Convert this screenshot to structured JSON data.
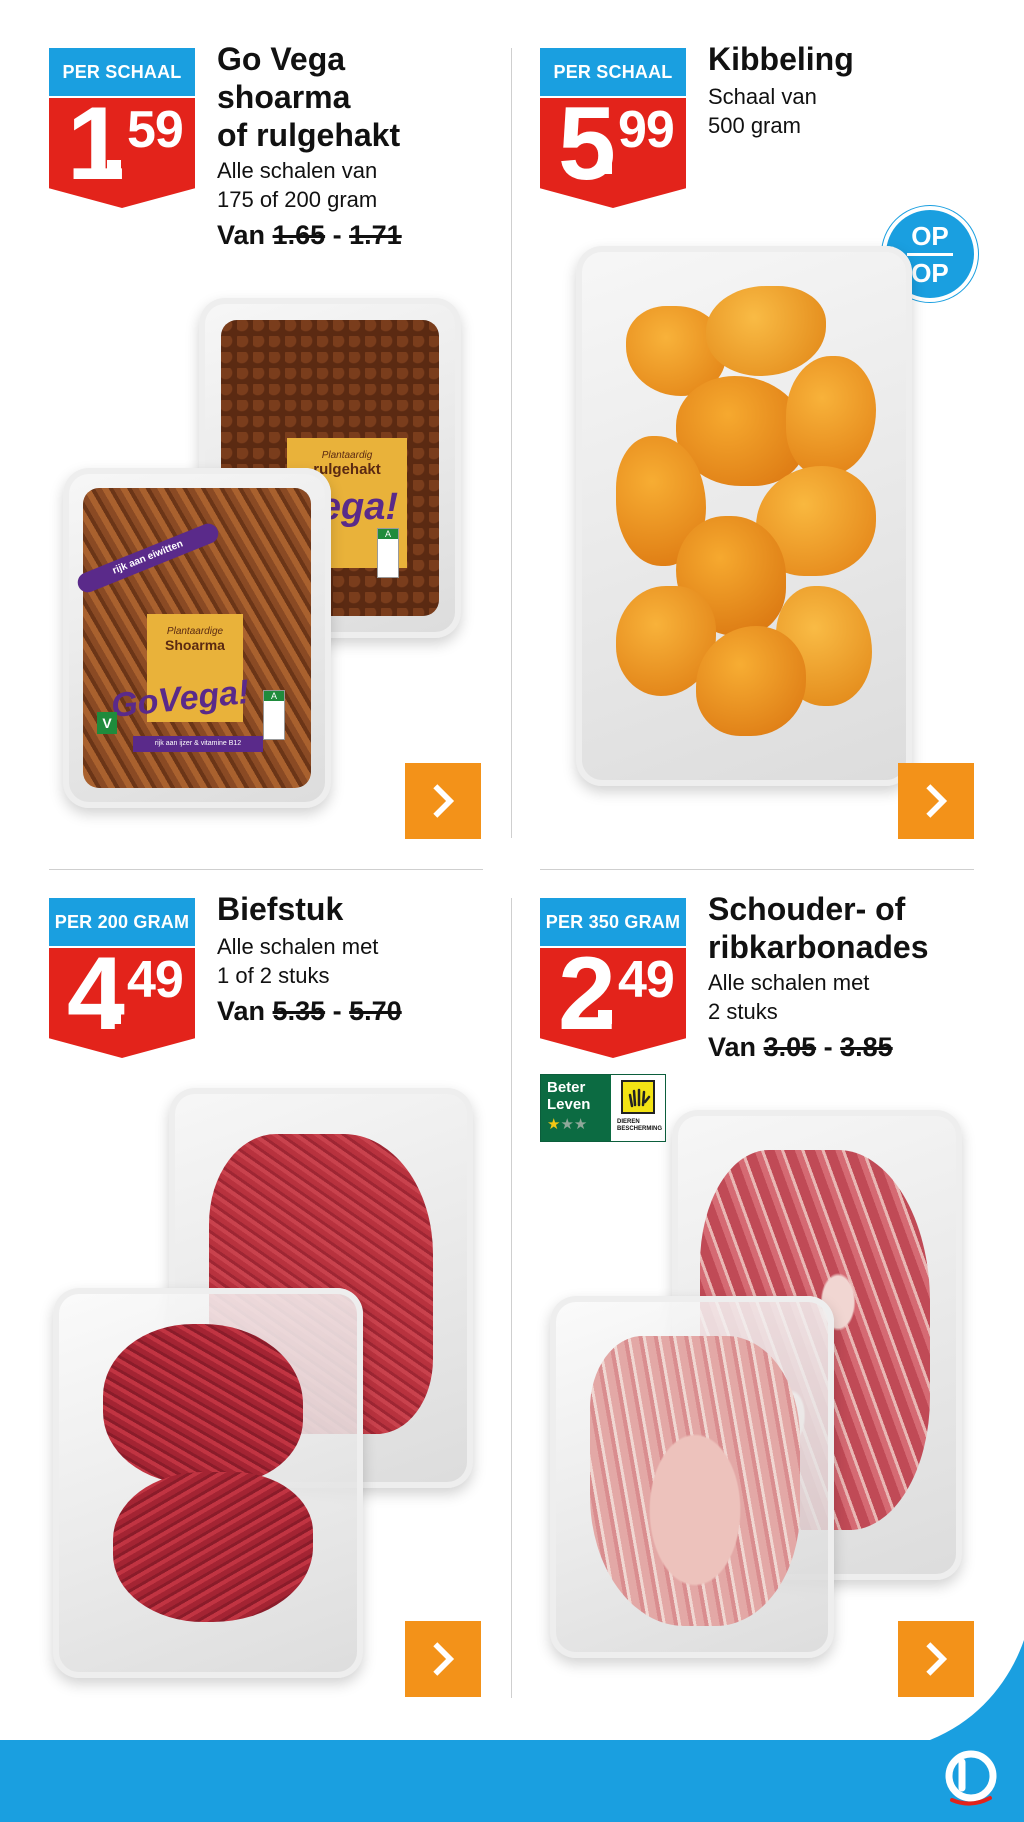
{
  "colors": {
    "price_red": "#e3231b",
    "unit_blue": "#1a9fe0",
    "arrow_orange": "#f39219",
    "beter_leven_green": "#0c6b42"
  },
  "offers": [
    {
      "unit": "PER SCHAAL",
      "price_int": "1",
      "price_dec": "59",
      "title_lines": [
        "Go Vega",
        "shoarma",
        "of rulgehakt"
      ],
      "desc_lines": [
        "Alle schalen van",
        "175 of 200 gram"
      ],
      "van_label": "Van",
      "old_price_a": "1.65",
      "old_price_sep": "-",
      "old_price_b": "1.71",
      "pack_texts": {
        "top_line": "Plantaardig",
        "top_name": "rulgehakt",
        "brand_top": "Vega!",
        "front_line": "Plantaardige",
        "front_name": "Shoarma",
        "brand": "GoVega!",
        "protein": "rijk aan eiwitten",
        "vitamins": "rijk aan ijzer & vitamine B12",
        "nutri_grade": "A",
        "vegan_mark": "V"
      },
      "arrow_icon": "chevron-right-icon"
    },
    {
      "unit": "PER SCHAAL",
      "price_int": "5",
      "price_dec": "99",
      "title_lines": [
        "Kibbeling"
      ],
      "desc_lines": [
        "Schaal van",
        "500 gram"
      ],
      "badge_top": "OP",
      "badge_bottom": "OP",
      "arrow_icon": "chevron-right-icon"
    },
    {
      "unit": "PER 200 GRAM",
      "price_int": "4",
      "price_dec": "49",
      "title_lines": [
        "Biefstuk"
      ],
      "desc_lines": [
        "Alle schalen met",
        "1 of 2 stuks"
      ],
      "van_label": "Van",
      "old_price_a": "5.35",
      "old_price_sep": "-",
      "old_price_b": "5.70",
      "arrow_icon": "chevron-right-icon"
    },
    {
      "unit": "PER 350 GRAM",
      "price_int": "2",
      "price_dec": "49",
      "title_lines": [
        "Schouder- of",
        "ribkarbonades"
      ],
      "desc_lines": [
        "Alle schalen met",
        "2 stuks"
      ],
      "van_label": "Van",
      "old_price_a": "3.05",
      "old_price_sep": "-",
      "old_price_b": "3.85",
      "label": {
        "line1": "Beter",
        "line2": "Leven",
        "stars_filled": 1,
        "stars_total": 3,
        "org_line1": "DIEREN",
        "org_line2": "BESCHERMING"
      },
      "arrow_icon": "chevron-right-icon"
    }
  ]
}
